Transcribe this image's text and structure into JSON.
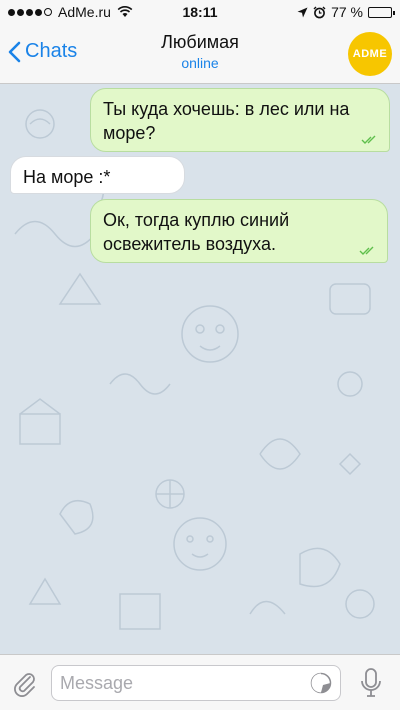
{
  "statusbar": {
    "carrier": "AdMe.ru",
    "time": "18:11",
    "battery": "77 %",
    "battery_level": 0.77
  },
  "navbar": {
    "back_label": "Chats",
    "contact_name": "Любимая",
    "contact_status": "online",
    "avatar_text": "ADME"
  },
  "messages": [
    {
      "direction": "out",
      "text": "Ты куда хочешь: в лес или на море?",
      "status": "read"
    },
    {
      "direction": "in",
      "text": "На море :*"
    },
    {
      "direction": "out",
      "text": "Ок, тогда куплю синий освежитель воздуха.",
      "status": "read"
    }
  ],
  "composer": {
    "placeholder": "Message"
  },
  "colors": {
    "accent": "#1a83e8",
    "outgoing_bubble": "#e2f8c9",
    "incoming_bubble": "#ffffff",
    "chat_background": "#d9e2ea",
    "avatar": "#f7c600",
    "read_ticks": "#5fbf4c"
  }
}
